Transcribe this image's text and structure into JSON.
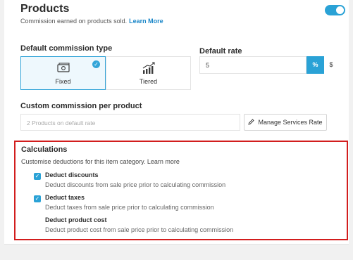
{
  "header": {
    "title": "Products",
    "subtitle": "Commission earned on products sold.",
    "learn_more": "Learn More",
    "toggle_on": true
  },
  "commission_type": {
    "label": "Default commission type",
    "options": [
      {
        "label": "Fixed",
        "icon": "cash-icon",
        "selected": true
      },
      {
        "label": "Tiered",
        "icon": "bar-chart-icon",
        "selected": false
      }
    ]
  },
  "default_rate": {
    "label": "Default rate",
    "value": "5",
    "percent_label": "%",
    "dollar_label": "$"
  },
  "custom_commission": {
    "label": "Custom commission per product",
    "placeholder": "2 Products on default rate",
    "manage_button": "Manage Services Rate"
  },
  "calculations": {
    "title": "Calculations",
    "description": "Customise deductions for this item category. Learn more",
    "items": [
      {
        "title": "Deduct discounts",
        "description": "Deduct discounts from sale price prior to calculating commission",
        "checked": true
      },
      {
        "title": "Deduct taxes",
        "description": "Deduct taxes from sale price prior to calculating commission",
        "checked": true
      },
      {
        "title": "Deduct product cost",
        "description": "Deduct product cost from sale price prior to calculating commission",
        "checked": false
      }
    ]
  },
  "colors": {
    "accent": "#2aa2d6",
    "highlight_border": "#d21d1d"
  }
}
